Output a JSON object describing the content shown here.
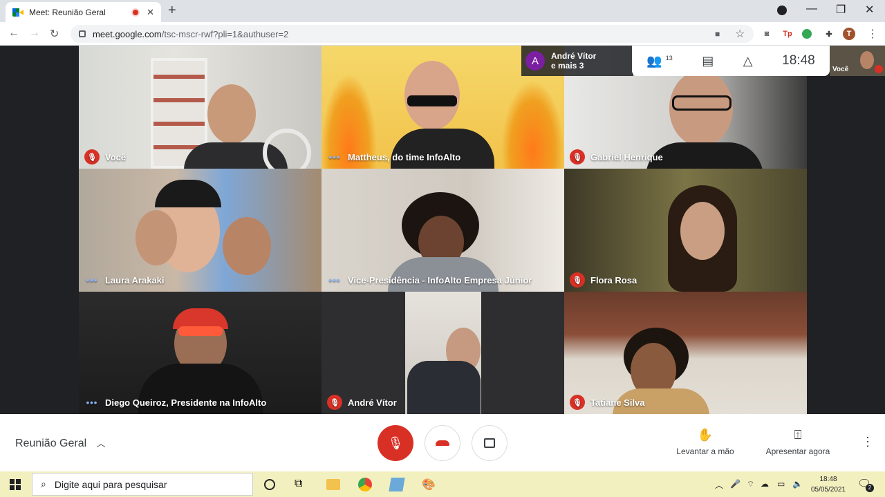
{
  "browser": {
    "tab_title": "Meet: Reunião Geral",
    "url_domain": "meet.google.com",
    "url_path": "/tsc-mscr-rwf?pli=1&authuser=2",
    "profile_initial": "T"
  },
  "meet": {
    "presenter": {
      "initial": "A",
      "line1": "André Vítor",
      "line2": "e mais 3"
    },
    "participants_count": "13",
    "time": "18:48",
    "self_label": "Você",
    "meeting_name": "Reunião Geral",
    "actions": {
      "raise_hand": "Levantar a mão",
      "present_now": "Apresentar agora"
    },
    "tiles": [
      {
        "name": "Você",
        "status": "muted"
      },
      {
        "name": "Mattheus, do time InfoAlto",
        "status": "speaking"
      },
      {
        "name": "Gabriel Henrique",
        "status": "muted"
      },
      {
        "name": "Laura Arakaki",
        "status": "speaking"
      },
      {
        "name": "Vice-Presidência - InfoAlto Empresa Júnior",
        "status": "speaking"
      },
      {
        "name": "Flora Rosa",
        "status": "muted"
      },
      {
        "name": "Diego Queiroz, Presidente na InfoAlto",
        "status": "speaking"
      },
      {
        "name": "André Vítor",
        "status": "muted"
      },
      {
        "name": "Tatiane Silva",
        "status": "muted"
      }
    ]
  },
  "taskbar": {
    "search_placeholder": "Digite aqui para pesquisar",
    "time": "18:48",
    "date": "05/05/2021",
    "notifications": "2"
  },
  "colors": {
    "mute_red": "#d93025",
    "meet_bg": "#202124",
    "taskbar_bg": "#f3f0c0"
  }
}
